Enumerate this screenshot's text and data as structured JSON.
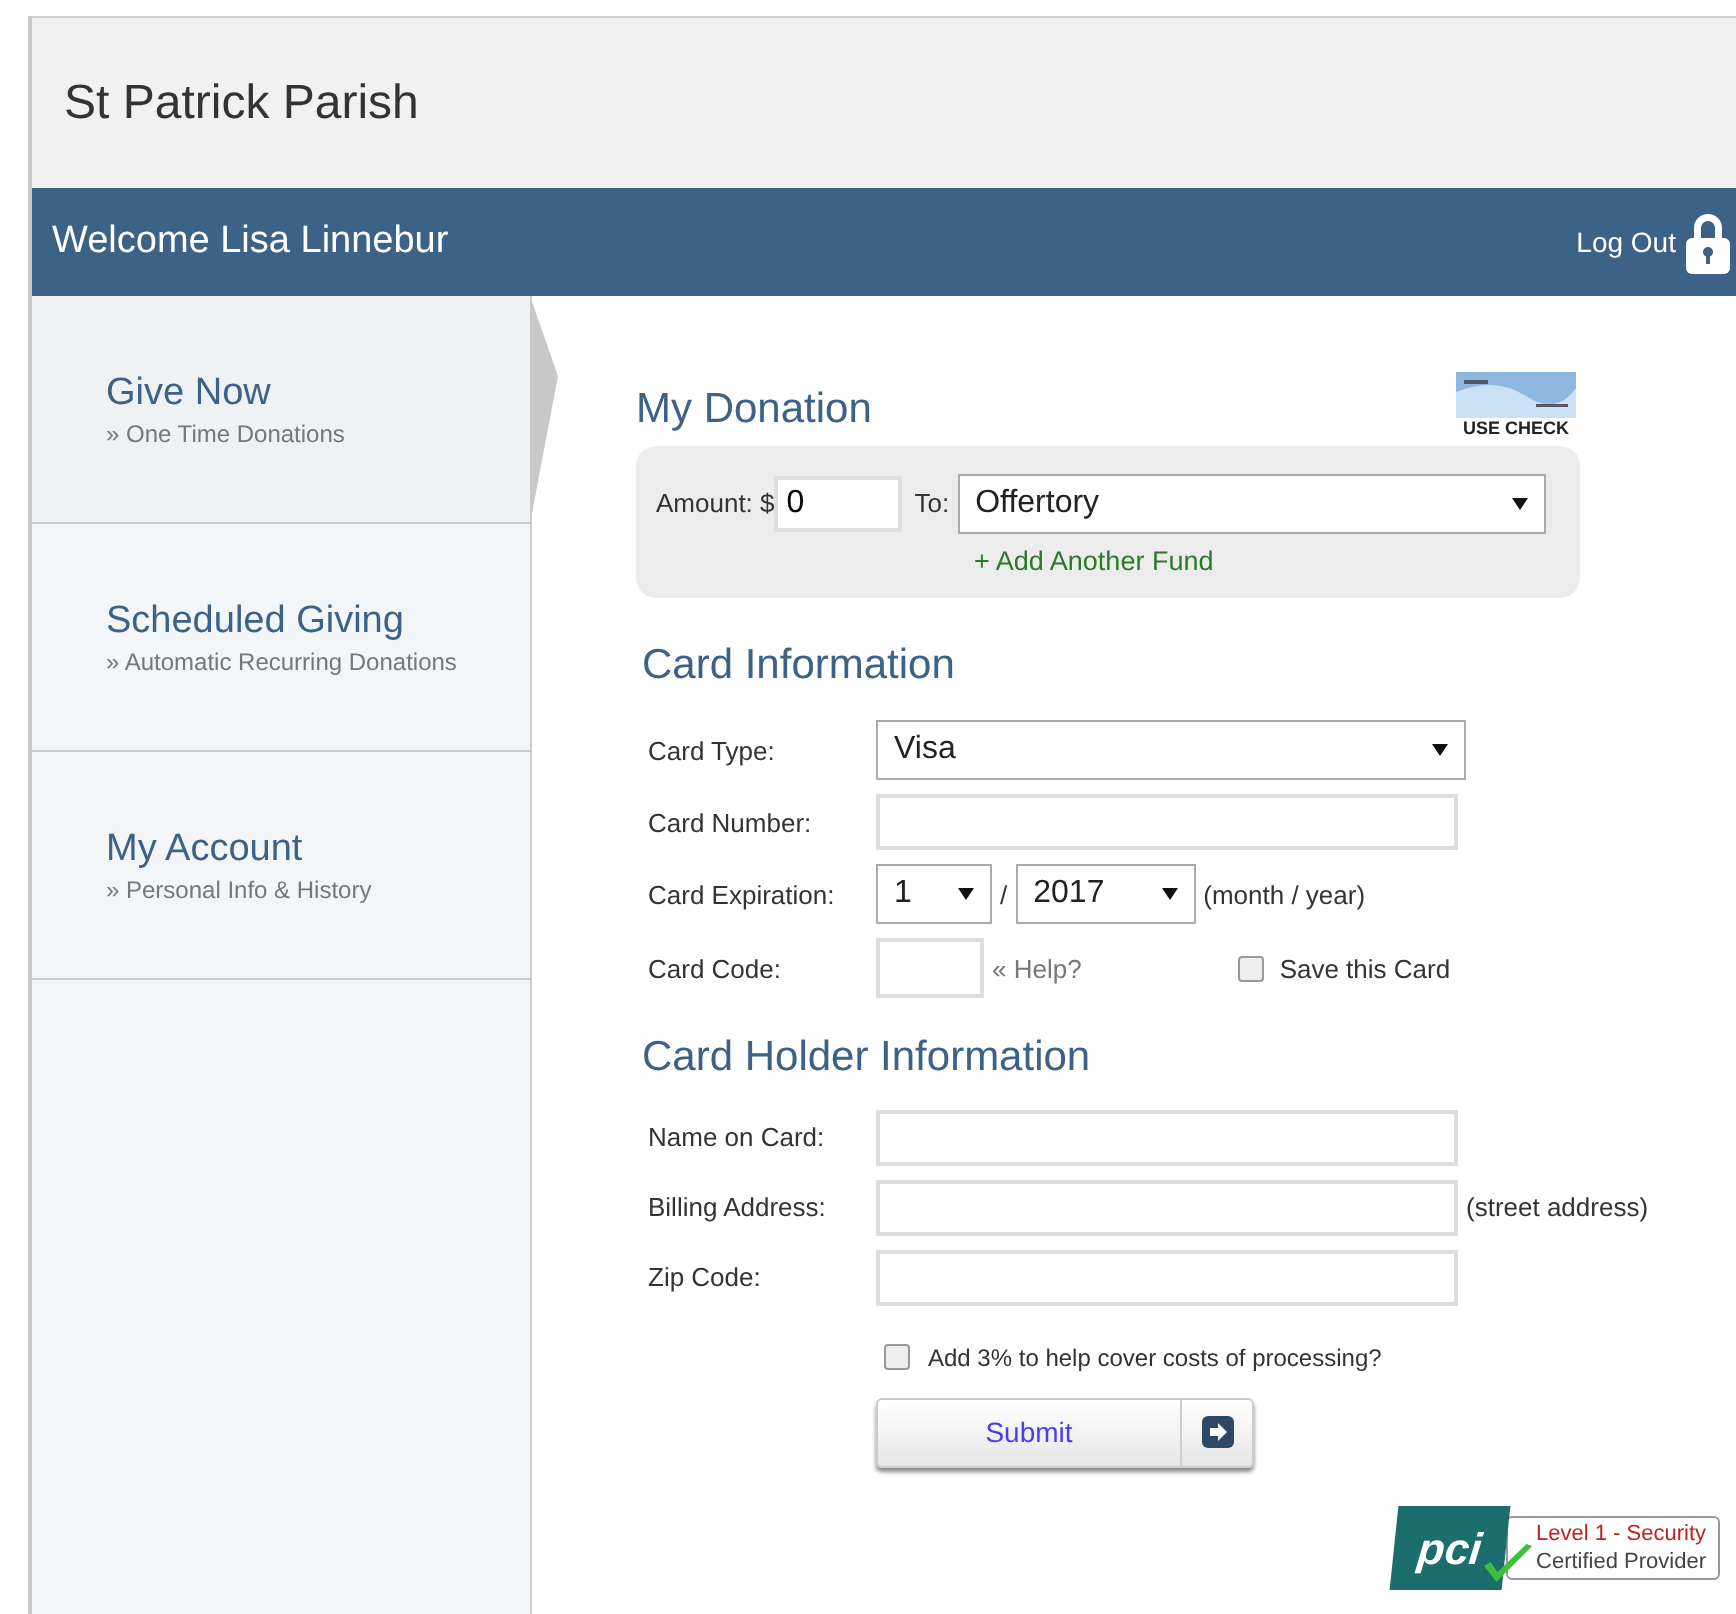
{
  "header": {
    "title": "St Patrick Parish"
  },
  "user_bar": {
    "welcome": "Welcome Lisa Linnebur",
    "logout": "Log Out"
  },
  "sidebar": {
    "items": [
      {
        "title": "Give Now",
        "subtitle": "» One Time Donations",
        "selected": true
      },
      {
        "title": "Scheduled Giving",
        "subtitle": "» Automatic Recurring Donations",
        "selected": false
      },
      {
        "title": "My Account",
        "subtitle": "» Personal Info & History",
        "selected": false
      }
    ]
  },
  "donation": {
    "title": "My Donation",
    "use_check": "USE CHECK",
    "amount_label": "Amount: $",
    "amount_value": "0",
    "to_label": "To:",
    "fund": "Offertory",
    "add_fund": "+ Add Another Fund"
  },
  "card": {
    "title": "Card Information",
    "type_label": "Card Type:",
    "type_value": "Visa",
    "number_label": "Card Number:",
    "expiration_label": "Card Expiration:",
    "month": "1",
    "separator": "/",
    "year": "2017",
    "expiration_hint": "(month / year)",
    "code_label": "Card Code:",
    "help": "« Help?",
    "save_label": "Save this Card",
    "save_checked": false
  },
  "holder": {
    "title": "Card Holder Information",
    "fields": [
      {
        "label": "Name on Card:"
      },
      {
        "label": "Billing Address:",
        "hint": "(street address)"
      },
      {
        "label": "Zip Code:"
      }
    ],
    "fee_label": "Add 3% to help cover costs of processing?",
    "fee_checked": false,
    "submit": "Submit"
  },
  "badge": {
    "logo": "pci",
    "line1": "Level 1 - Security",
    "line2": "Certified Provider"
  }
}
